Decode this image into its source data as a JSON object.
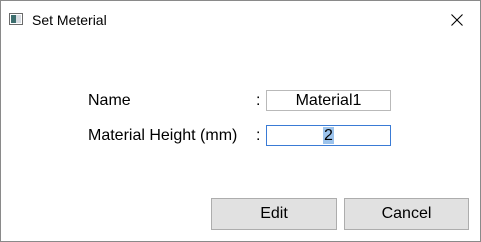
{
  "window": {
    "title": "Set Meterial"
  },
  "form": {
    "name_label": "Name",
    "name_colon": ":",
    "name_value": "Material1",
    "height_label": "Material Height (mm)",
    "height_colon": ":",
    "height_value": "2"
  },
  "buttons": {
    "edit_label": "Edit",
    "cancel_label": "Cancel"
  },
  "colors": {
    "focus_border": "#3a7bd5",
    "selection": "#9cc3ec",
    "button_face": "#e1e1e1"
  },
  "icons": {
    "app": "window-app-icon",
    "close": "close-icon"
  }
}
